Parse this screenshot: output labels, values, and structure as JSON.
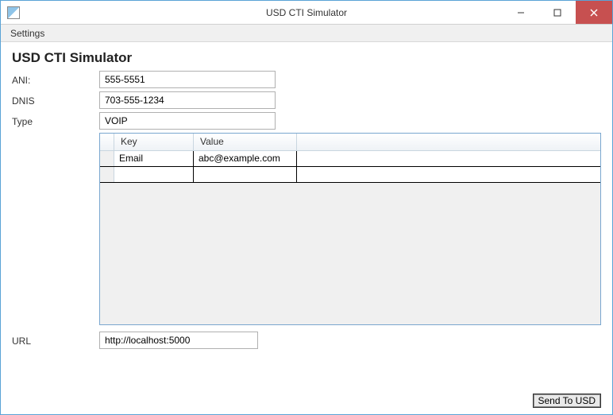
{
  "window": {
    "title": "USD CTI Simulator"
  },
  "menubar": {
    "settings": "Settings"
  },
  "heading": "USD CTI Simulator",
  "form": {
    "ani_label": "ANI:",
    "ani_value": "555-5551",
    "dnis_label": "DNIS",
    "dnis_value": "703-555-1234",
    "type_label": "Type",
    "type_value": "VOIP",
    "url_label": "URL",
    "url_value": "http://localhost:5000"
  },
  "grid": {
    "headers": {
      "key": "Key",
      "value": "Value"
    },
    "rows": [
      {
        "key": "Email",
        "value": "abc@example.com"
      }
    ]
  },
  "buttons": {
    "send": "Send To USD"
  }
}
